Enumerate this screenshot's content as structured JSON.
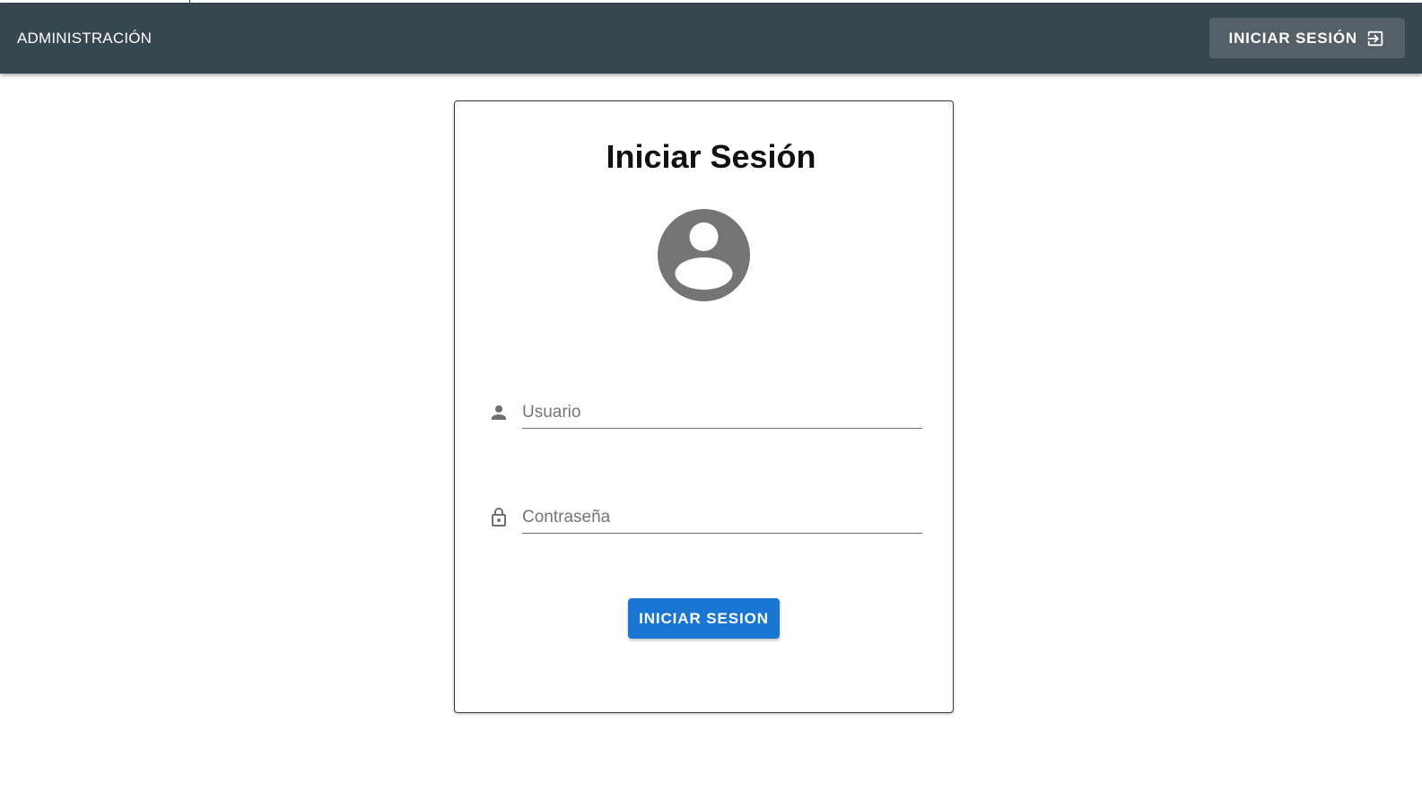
{
  "header": {
    "brand": "ADMINISTRACIÓN",
    "login_button_label": "INICIAR SESIÓN",
    "login_button_icon": "login-icon",
    "background_color": "#37474f"
  },
  "login_card": {
    "title": "Iniciar Sesión",
    "avatar_icon": "account-circle-icon",
    "username": {
      "icon": "person-icon",
      "placeholder": "Usuario",
      "value": ""
    },
    "password": {
      "icon": "lock-icon",
      "placeholder": "Contraseña",
      "value": ""
    },
    "submit_label": "INICIAR SESION",
    "submit_color": "#1976d2"
  }
}
